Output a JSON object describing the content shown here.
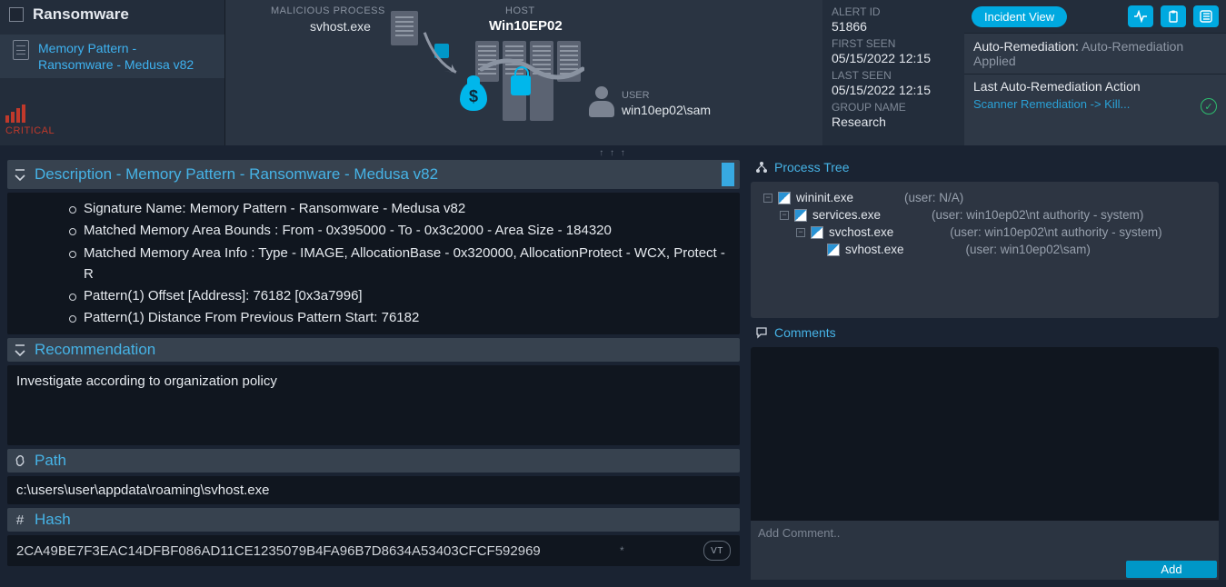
{
  "header": {
    "title": "Ransomware",
    "detection_item": "Memory Pattern - Ransomware - Medusa v82",
    "severity": "CRITICAL",
    "malicious_process_label": "MALICIOUS PROCESS",
    "malicious_process": "svhost.exe",
    "host_label": "HOST",
    "host": "Win10EP02",
    "user_label": "USER",
    "user": "win10ep02\\sam"
  },
  "info": {
    "alert_id_label": "ALERT ID",
    "alert_id": "51866",
    "first_seen_label": "FIRST SEEN",
    "first_seen": "05/15/2022 12:15",
    "last_seen_label": "LAST SEEN",
    "last_seen": "05/15/2022 12:15",
    "group_label": "GROUP NAME",
    "group": "Research"
  },
  "right": {
    "incident_btn": "Incident View",
    "autorem_label": "Auto-Remediation:",
    "autorem_value": "Auto-Remediation Applied",
    "last_action_label": "Last Auto-Remediation Action",
    "last_action_link": "Scanner Remediation -> Kill..."
  },
  "description": {
    "title": "Description - Memory Pattern - Ransomware - Medusa v82",
    "bullets": [
      "Signature Name: Memory Pattern - Ransomware - Medusa v82",
      "Matched Memory Area Bounds : From - 0x395000 - To - 0x3c2000 - Area Size - 184320",
      "Matched Memory Area Info : Type - IMAGE, AllocationBase - 0x320000, AllocationProtect - WCX, Protect - R",
      "Pattern(1) Offset [Address]: 76182 [0x3a7996]",
      "Pattern(1) Distance From Previous Pattern Start: 76182"
    ]
  },
  "recommendation": {
    "title": "Recommendation",
    "text": "Investigate according to organization policy"
  },
  "path": {
    "title": "Path",
    "value": "c:\\users\\user\\appdata\\roaming\\svhost.exe"
  },
  "hash": {
    "title": "Hash",
    "value": "2CA49BE7F3EAC14DFBF086AD11CE1235079B4FA96B7D8634A53403CFCF592969",
    "vt": "VT"
  },
  "process_tree": {
    "title": "Process Tree",
    "rows": [
      {
        "name": "wininit.exe",
        "user": "(user: N/A)",
        "indent": 0
      },
      {
        "name": "services.exe",
        "user": "(user: win10ep02\\nt authority - system)",
        "indent": 1
      },
      {
        "name": "svchost.exe",
        "user": "(user: win10ep02\\nt authority - system)",
        "indent": 2
      },
      {
        "name": "svhost.exe",
        "user": "(user: win10ep02\\sam)",
        "indent": 3
      }
    ]
  },
  "comments": {
    "title": "Comments",
    "placeholder": "Add Comment..",
    "add_label": "Add"
  }
}
